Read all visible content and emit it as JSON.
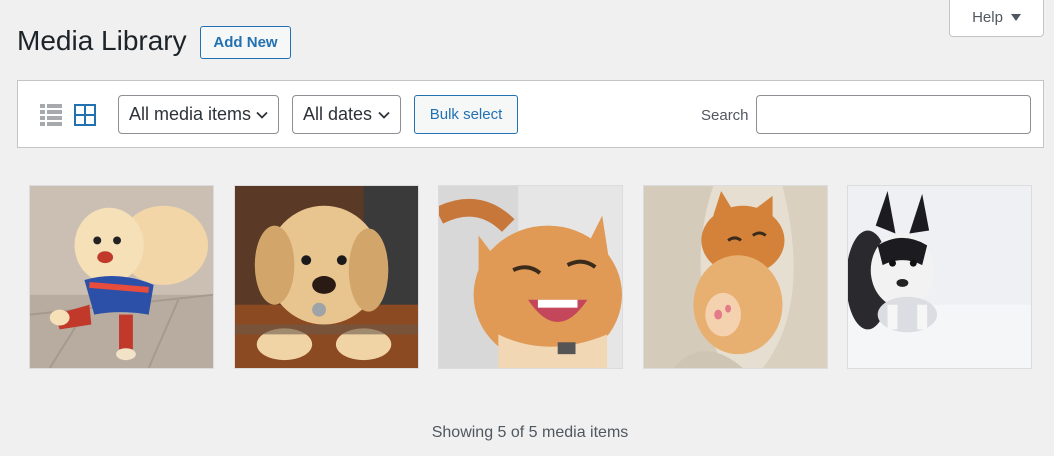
{
  "help": {
    "label": "Help"
  },
  "header": {
    "title": "Media Library",
    "add_new_label": "Add New"
  },
  "toolbar": {
    "filter_type": "All media items",
    "filter_date": "All dates",
    "bulk_select_label": "Bulk select",
    "search_label": "Search",
    "search_value": ""
  },
  "media": [
    {
      "kind": "pomeranian-dog"
    },
    {
      "kind": "labrador-puppy"
    },
    {
      "kind": "laughing-cat"
    },
    {
      "kind": "sleeping-kitten"
    },
    {
      "kind": "husky-puppy"
    }
  ],
  "footer": {
    "count_text": "Showing 5 of 5 media items"
  },
  "colors": {
    "accent": "#2271b1",
    "background": "#f0f0f1",
    "border": "#c3c4c7"
  }
}
